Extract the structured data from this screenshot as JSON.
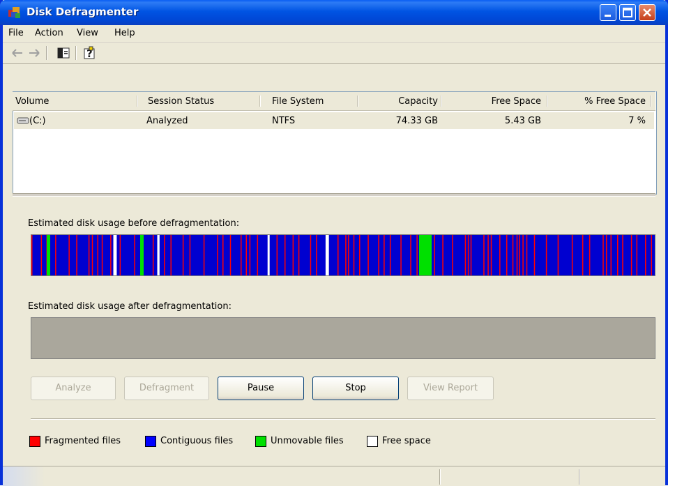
{
  "window": {
    "title": "Disk Defragmenter"
  },
  "menu": {
    "file": "File",
    "action": "Action",
    "view": "View",
    "help": "Help"
  },
  "toolbar": {
    "icons": [
      "back-arrow-icon",
      "forward-arrow-icon",
      "show-hide-tree-icon",
      "help-icon"
    ]
  },
  "volume_list": {
    "headers": {
      "volume": "Volume",
      "session_status": "Session Status",
      "file_system": "File System",
      "capacity": "Capacity",
      "free_space": "Free Space",
      "pct_free": "% Free Space"
    },
    "rows": [
      {
        "volume": "(C:)",
        "session_status": "Analyzed",
        "file_system": "NTFS",
        "capacity": "74.33 GB",
        "free_space": "5.43 GB",
        "pct_free": "7 %"
      }
    ]
  },
  "analysis": {
    "before_label": "Estimated disk usage before defragmentation:",
    "after_label": "Estimated disk usage after defragmentation:"
  },
  "buttons": {
    "analyze": "Analyze",
    "defragment": "Defragment",
    "pause": "Pause",
    "stop": "Stop",
    "view_report": "View Report"
  },
  "legend": {
    "fragmented": {
      "label": "Fragmented files",
      "color": "#ff0000"
    },
    "contiguous": {
      "label": "Contiguous files",
      "color": "#0000ff"
    },
    "unmovable": {
      "label": "Unmovable files",
      "color": "#00e000"
    },
    "free": {
      "label": "Free space",
      "color": "#ffffff"
    }
  },
  "colors": {
    "bar_background": "#0000d0",
    "after_background": "#aaa79c"
  }
}
